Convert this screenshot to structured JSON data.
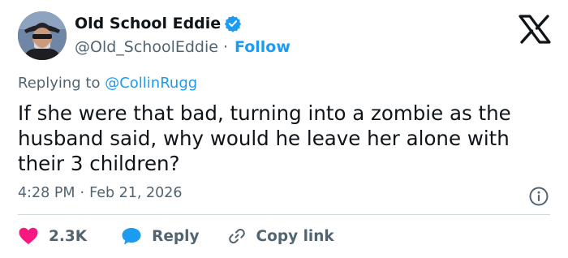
{
  "author": {
    "name": "Old School Eddie",
    "handle": "@Old_SchoolEddie",
    "follow_label": "Follow",
    "verified_icon": "verified-badge-icon",
    "avatar_icon": "avatar-photo"
  },
  "brand": {
    "logo_icon": "x-logo-icon"
  },
  "replying": {
    "prefix": "Replying to",
    "to": "@CollinRugg"
  },
  "tweet": {
    "text": "If she were that bad, turning into a zombie as the husband said, why would he leave her alone with their 3 children?",
    "time": "4:28 PM",
    "date": "Feb 21, 2026",
    "separator": "·"
  },
  "actions": {
    "like_count": "2.3K",
    "reply_label": "Reply",
    "copy_link_label": "Copy link"
  },
  "colors": {
    "accent": "#1d9bf0",
    "like": "#f91880",
    "text": "#0f1419",
    "muted": "#536471"
  }
}
